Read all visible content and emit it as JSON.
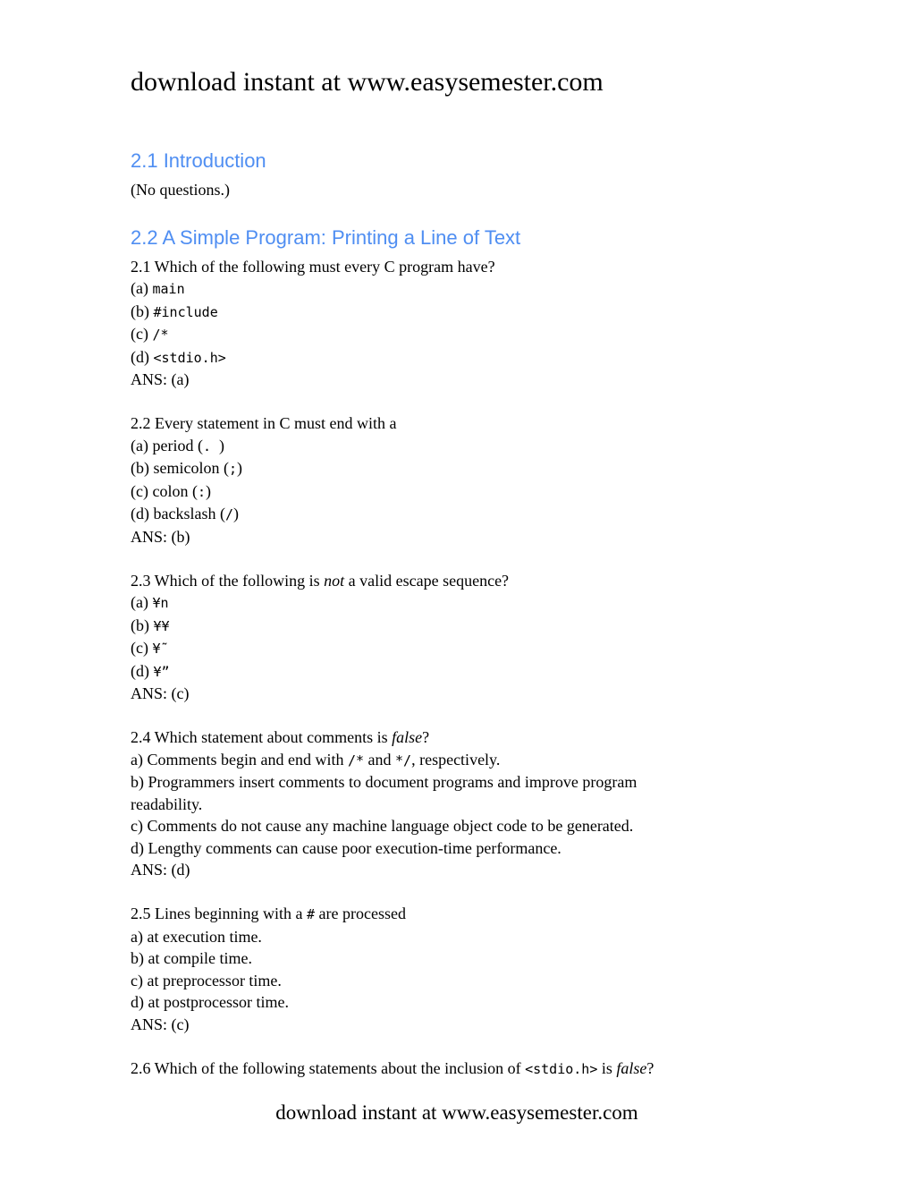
{
  "header": {
    "text": "download instant at www.easysemester.com"
  },
  "footer": {
    "text": "download instant at www.easysemester.com"
  },
  "sections": [
    {
      "heading": "2.1  Introduction",
      "note": "(No questions.)"
    },
    {
      "heading": "2.2  A Simple Program: Printing a Line of Text"
    }
  ],
  "questions": {
    "q1": {
      "prompt": "2.1  Which of the following must every C program have?",
      "options": [
        {
          "label": "(a)  ",
          "code": "main"
        },
        {
          "label": "(b)  ",
          "code": "#include"
        },
        {
          "label": "(c)  ",
          "code": "/*"
        },
        {
          "label": "(d)  ",
          "code": "<stdio.h>"
        }
      ],
      "answer": "ANS: (a)"
    },
    "q2": {
      "prompt": "2.2  Every statement in C must end with a",
      "options": [
        {
          "label": "(a)  period (",
          "code": ". ",
          "after": ")"
        },
        {
          "label": "(b)  semicolon (",
          "code": ";",
          "after": ")"
        },
        {
          "label": "(c)  colon (",
          "code": ":",
          "after": ")"
        },
        {
          "label": "(d)  backslash (",
          "code": "/",
          "after": ")"
        }
      ],
      "answer": "ANS: (b)"
    },
    "q3": {
      "prompt_before": "2.3  Which of the following is ",
      "prompt_em": "not",
      "prompt_after": " a valid escape sequence?",
      "options": [
        {
          "label": "(a)  ",
          "code": "¥n"
        },
        {
          "label": "(b)  ",
          "code": "¥¥"
        },
        {
          "label": "(c)  ",
          "code": "¥˜"
        },
        {
          "label": "(d)  ",
          "code": "¥”"
        }
      ],
      "answer": "ANS: (c)"
    },
    "q4": {
      "prompt_before": "2.4  Which statement about comments is ",
      "prompt_em": "false",
      "prompt_after": "?",
      "options": [
        {
          "before": "a) Comments begin and end with ",
          "code1": "/*",
          "mid": " and ",
          "code2": "*/",
          "after": ", respectively."
        },
        {
          "text": "b) Programmers insert comments to document programs and improve program readability."
        },
        {
          "text": "c) Comments do not cause any machine language object code to be generated."
        },
        {
          "text": "d) Lengthy comments can cause poor execution-time performance."
        }
      ],
      "answer": "ANS: (d)"
    },
    "q5": {
      "prompt_before": "2.5  Lines beginning with a ",
      "prompt_code": "#",
      "prompt_after": " are processed",
      "options": [
        {
          "text": "a) at execution time."
        },
        {
          "text": "b) at compile time."
        },
        {
          "text": "c) at preprocessor time."
        },
        {
          "text": "d) at postprocessor time."
        }
      ],
      "answer": "ANS: (c)"
    },
    "q6": {
      "prompt_before": "2.6  Which of the following statements about the inclusion of ",
      "prompt_code": "<stdio.h>",
      "prompt_mid": " is ",
      "prompt_em": "false",
      "prompt_after": "?"
    }
  }
}
